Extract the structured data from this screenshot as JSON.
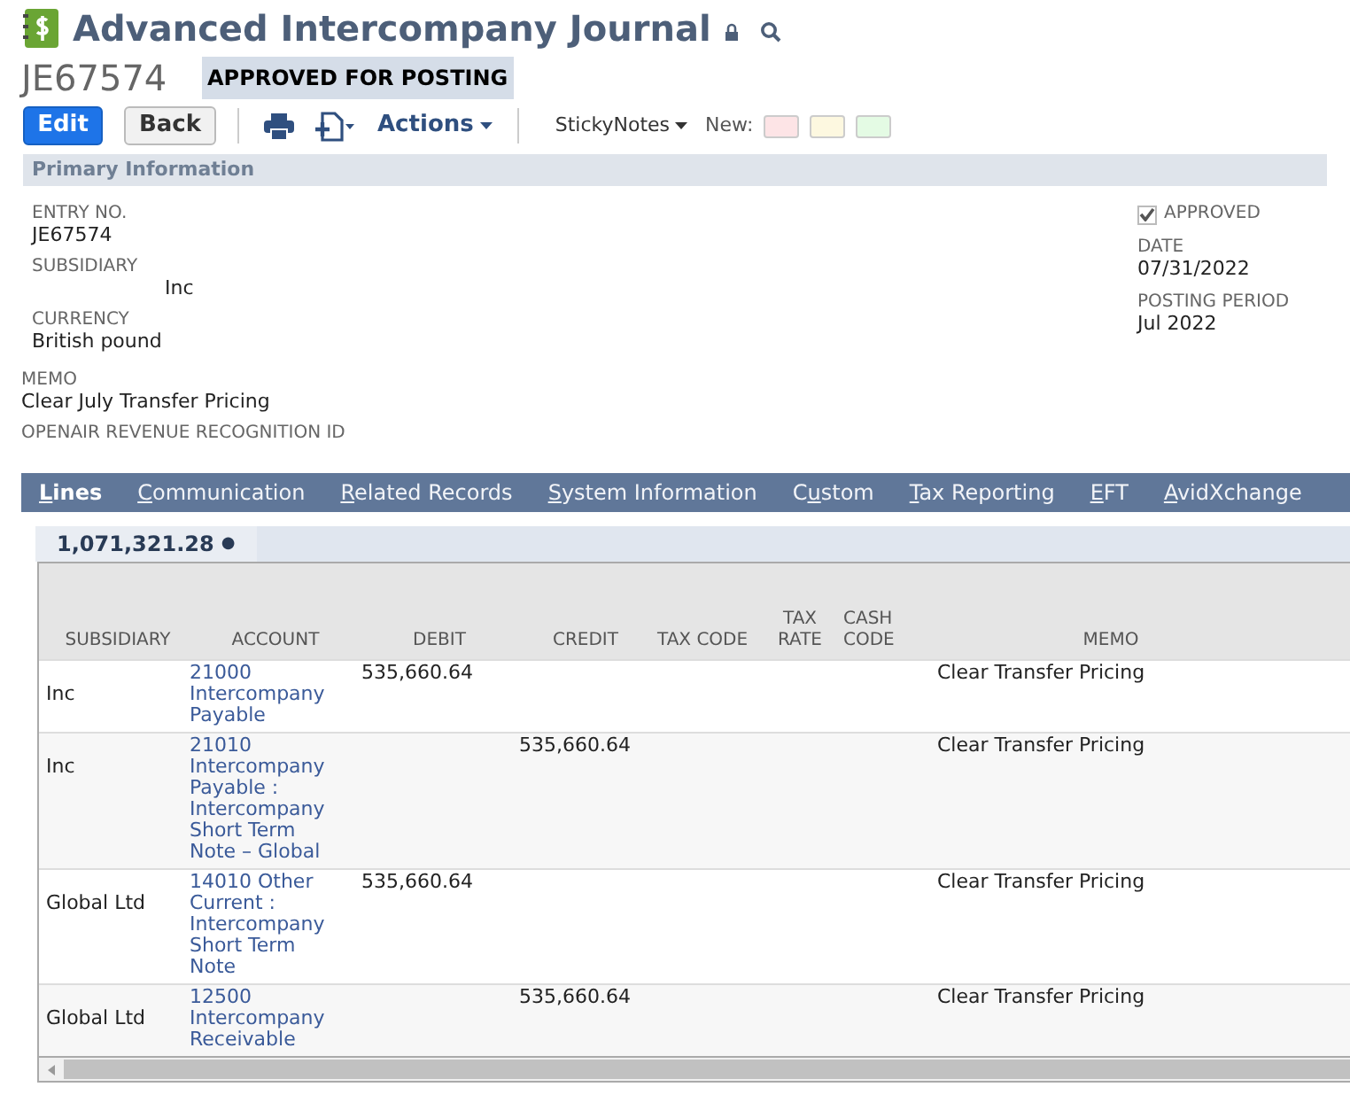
{
  "header": {
    "title": "Advanced Intercompany Journal",
    "record_id": "JE67574",
    "status": "APPROVED FOR POSTING"
  },
  "toolbar": {
    "edit": "Edit",
    "back": "Back",
    "actions": "Actions",
    "sticky_notes": "StickyNotes",
    "new_label": "New:",
    "note_colors": [
      {
        "color": "#fde4e6"
      },
      {
        "color": "#fdf8e0"
      },
      {
        "color": "#e4fbe4"
      }
    ]
  },
  "primary": {
    "title": "Primary Information",
    "left_fields": [
      {
        "label": "ENTRY NO.",
        "value": "JE67574"
      },
      {
        "label": "SUBSIDIARY",
        "value": "Inc"
      },
      {
        "label": "CURRENCY",
        "value": "British pound"
      }
    ],
    "approved": {
      "label": "APPROVED",
      "checked": true
    },
    "right_fields": [
      {
        "label": "DATE",
        "value": "07/31/2022"
      },
      {
        "label": "POSTING PERIOD",
        "value": "Jul 2022"
      }
    ],
    "memo": {
      "label": "MEMO",
      "value": "Clear July Transfer Pricing"
    },
    "openair": {
      "label": "OPENAIR REVENUE RECOGNITION ID"
    }
  },
  "tabs": [
    {
      "key": "L",
      "after": "ines",
      "selected": true
    },
    {
      "key": "C",
      "after": "ommunication",
      "selected": false
    },
    {
      "key": "R",
      "after": "elated Records",
      "selected": false
    },
    {
      "key": "S",
      "after": "ystem Information",
      "selected": false
    },
    {
      "before": "C",
      "key": "u",
      "after": "stom",
      "selected": false
    },
    {
      "key": "T",
      "after": "ax Reporting",
      "selected": false
    },
    {
      "key": "E",
      "after": "FT",
      "selected": false
    },
    {
      "key": "A",
      "after": "vidXchange",
      "selected": false
    }
  ],
  "subtab": {
    "label": "1,071,321.28",
    "dot": "●"
  },
  "table": {
    "columns": [
      "SUBSIDIARY",
      "ACCOUNT",
      "DEBIT",
      "CREDIT",
      "TAX CODE",
      "TAX RATE",
      "CASH CODE",
      "MEMO"
    ],
    "rows": [
      {
        "subsidiary": "Inc",
        "account": "21000 Intercompany Payable",
        "debit": "535,660.64",
        "credit": "",
        "memo": "Clear Transfer Pricing"
      },
      {
        "subsidiary": "Inc",
        "account": "21010 Intercompany Payable : Intercompany Short Term Note – Global",
        "debit": "",
        "credit": "535,660.64",
        "memo": "Clear Transfer Pricing"
      },
      {
        "subsidiary": "Global Ltd",
        "account": "14010 Other Current : Intercompany Short Term Note",
        "debit": "535,660.64",
        "credit": "",
        "memo": "Clear Transfer Pricing"
      },
      {
        "subsidiary": "Global Ltd",
        "account": "12500 Intercompany Receivable",
        "debit": "",
        "credit": "535,660.64",
        "memo": "Clear Transfer Pricing"
      }
    ]
  }
}
